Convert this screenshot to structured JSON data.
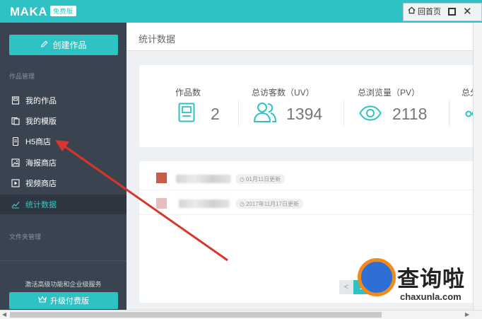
{
  "app": {
    "logo_text": "MAKA",
    "logo_badge": "免费版",
    "home_label": "回首页",
    "accent": "#2ec2c5"
  },
  "sidebar": {
    "create_label": "创建作品",
    "section_works": "作品管理",
    "section_folders": "文件夹管理",
    "items": [
      {
        "label": "我的作品",
        "icon": "my-works-icon"
      },
      {
        "label": "我的模版",
        "icon": "my-templates-icon"
      },
      {
        "label": "H5商店",
        "icon": "h5-store-icon"
      },
      {
        "label": "海报商店",
        "icon": "poster-store-icon"
      },
      {
        "label": "视频商店",
        "icon": "video-store-icon"
      },
      {
        "label": "统计数据",
        "icon": "statistics-icon",
        "active": true
      }
    ],
    "promo_text": "激活高级功能和企业级服务",
    "upgrade_label": "升级付费版"
  },
  "main": {
    "title": "统计数据",
    "stats": [
      {
        "label": "作品数",
        "value": "2",
        "icon": "works-count-icon"
      },
      {
        "label": "总访客数（UV）",
        "value": "1394",
        "icon": "visitors-icon"
      },
      {
        "label": "总浏览量（PV）",
        "value": "2118",
        "icon": "eye-icon"
      },
      {
        "label": "总分",
        "value": "",
        "icon": "share-icon"
      }
    ],
    "works": [
      {
        "date": "01月11日更新"
      },
      {
        "date": "2017年11月17日更新"
      }
    ],
    "pager": {
      "prev": "<",
      "current": "1"
    }
  },
  "watermark": {
    "text": "查询啦",
    "url": "chaxunla.com"
  }
}
